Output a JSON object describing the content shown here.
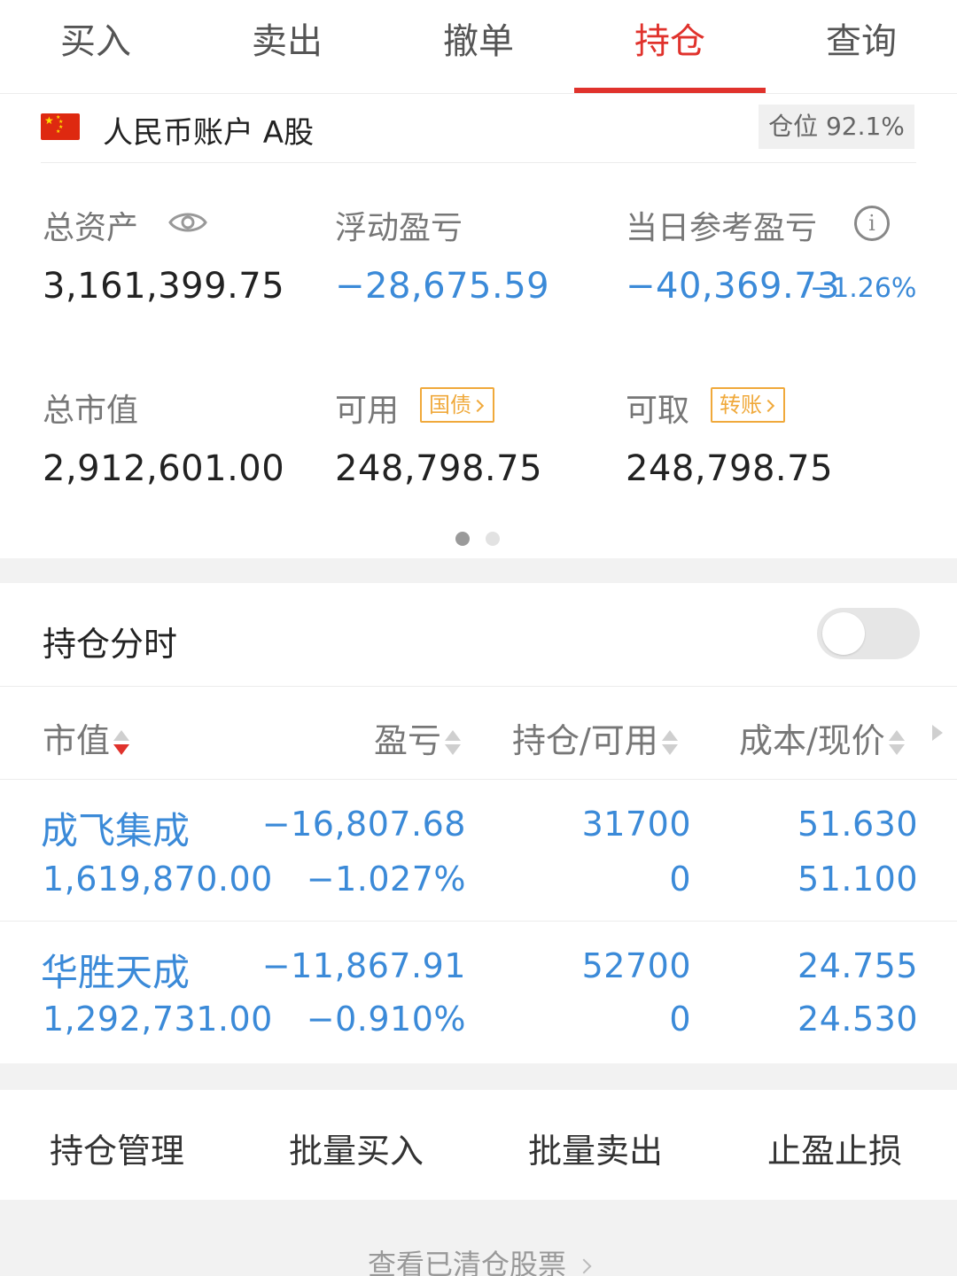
{
  "tabs": [
    {
      "label": "买入",
      "active": false
    },
    {
      "label": "卖出",
      "active": false
    },
    {
      "label": "撤单",
      "active": false
    },
    {
      "label": "持仓",
      "active": true
    },
    {
      "label": "查询",
      "active": false
    }
  ],
  "account": {
    "name": "人民币账户 A股",
    "position_badge": "仓位 92.1%"
  },
  "summary": {
    "total_assets_label": "总资产",
    "total_assets_value": "3,161,399.75",
    "floating_pl_label": "浮动盈亏",
    "floating_pl_value": "−28,675.59",
    "daily_pl_label": "当日参考盈亏",
    "daily_pl_value": "−40,369.73",
    "daily_pl_pct": "−1.26%",
    "market_value_label": "总市值",
    "market_value_value": "2,912,601.00",
    "available_label": "可用",
    "available_tag": "国债",
    "available_value": "248,798.75",
    "withdrawable_label": "可取",
    "withdrawable_tag": "转账",
    "withdrawable_value": "248,798.75"
  },
  "pager": {
    "pages": 2,
    "current": 1
  },
  "holdings_timeshare": {
    "label": "持仓分时",
    "enabled": false
  },
  "table": {
    "headers": [
      "市值",
      "盈亏",
      "持仓/可用",
      "成本/现价"
    ],
    "rows": [
      {
        "name": "成飞集成",
        "market_value": "1,619,870.00",
        "pl": "−16,807.68",
        "pl_pct": "−1.027%",
        "position": "31700",
        "available": "0",
        "cost": "51.630",
        "price": "51.100"
      },
      {
        "name": "华胜天成",
        "market_value": "1,292,731.00",
        "pl": "−11,867.91",
        "pl_pct": "−0.910%",
        "position": "52700",
        "available": "0",
        "cost": "24.755",
        "price": "24.530"
      }
    ]
  },
  "actions": [
    "持仓管理",
    "批量买入",
    "批量卖出",
    "止盈止损"
  ],
  "footer_link": "查看已清仓股票",
  "colors": {
    "accent_red": "#e0322c",
    "loss_blue": "#3b8ad8",
    "tag_orange": "#f0a93b"
  }
}
